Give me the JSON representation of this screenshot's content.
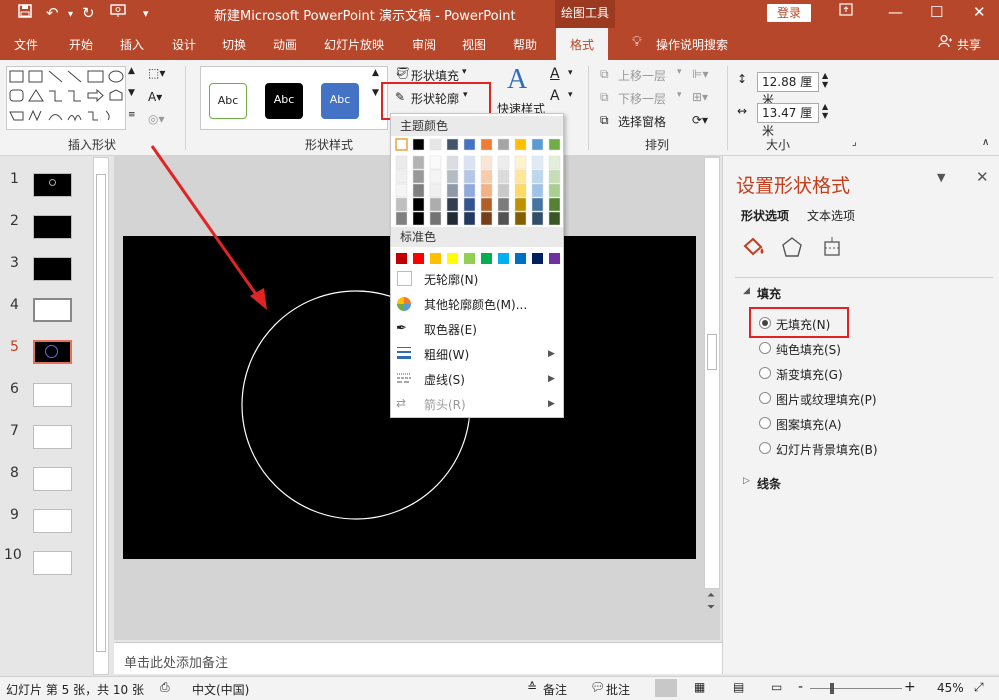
{
  "titlebar": {
    "title": "新建Microsoft PowerPoint 演示文稿  -  PowerPoint",
    "context_tab": "绘图工具",
    "login": "登录",
    "icons": [
      "save-icon",
      "undo-icon",
      "redo-icon",
      "present-icon",
      "customize-icon"
    ]
  },
  "tabs": [
    "文件",
    "开始",
    "插入",
    "设计",
    "切换",
    "动画",
    "幻灯片放映",
    "审阅",
    "视图",
    "帮助",
    "格式"
  ],
  "active_tab": "格式",
  "tell_me": "操作说明搜索",
  "share": "共享",
  "ribbon": {
    "insert_shapes_label": "插入形状",
    "shape_styles_label": "形状样式",
    "styles": [
      "Abc",
      "Abc",
      "Abc"
    ],
    "shape_fill": "形状填充",
    "shape_outline": "形状轮廓",
    "quick_styles": "快速样式",
    "bring_forward": "上移一层",
    "send_backward": "下移一层",
    "selection_pane": "选择窗格",
    "arrange_label": "排列",
    "size_label": "大小",
    "height": "12.88 厘米",
    "width": "13.47 厘米"
  },
  "slides": [
    "1",
    "2",
    "3",
    "4",
    "5",
    "6",
    "7",
    "8",
    "9",
    "10"
  ],
  "selected_slide": "5",
  "notes_placeholder": "单击此处添加备注",
  "format_pane": {
    "title": "设置形状格式",
    "tab_shape": "形状选项",
    "tab_text": "文本选项",
    "fill_section": "填充",
    "fill_options": [
      "无填充(N)",
      "纯色填充(S)",
      "渐变填充(G)",
      "图片或纹理填充(P)",
      "图案填充(A)",
      "幻灯片背景填充(B)"
    ],
    "selected_fill": "无填充(N)",
    "line_section": "线条"
  },
  "dropdown": {
    "theme_colors_label": "主题颜色",
    "standard_colors_label": "标准色",
    "no_outline": "无轮廓(N)",
    "more_colors": "其他轮廓颜色(M)...",
    "eyedropper": "取色器(E)",
    "weight": "粗细(W)",
    "dashes": "虚线(S)",
    "arrows": "箭头(R)",
    "theme_colors": [
      "#ffffff",
      "#000000",
      "#e7e6e6",
      "#44546a",
      "#4472c4",
      "#ed7d31",
      "#a5a5a5",
      "#ffc000",
      "#5b9bd5",
      "#70ad47"
    ],
    "standard_colors": [
      "#c00000",
      "#ff0000",
      "#ffc000",
      "#ffff00",
      "#92d050",
      "#00b050",
      "#00b0f0",
      "#0070c0",
      "#002060",
      "#7030a0"
    ]
  },
  "status": {
    "slide_info": "幻灯片 第 5 张，共 10 张",
    "language": "中文(中国)",
    "notes": "备注",
    "comments": "批注",
    "zoom": "45%",
    "zoom_out": "-",
    "zoom_in": "+"
  },
  "colors": {
    "accent": "#b7472a",
    "annotation_red": "#e02424"
  }
}
